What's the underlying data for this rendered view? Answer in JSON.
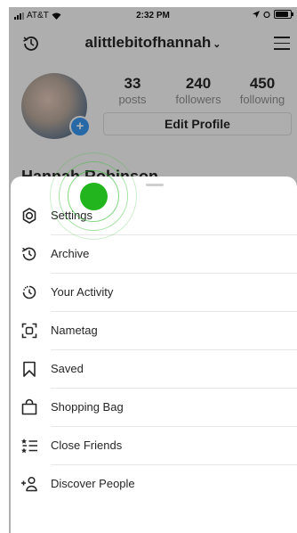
{
  "status_bar": {
    "carrier": "AT&T",
    "time": "2:32 PM"
  },
  "header": {
    "username": "alittlebitofhannah",
    "chevron": "⌄"
  },
  "profile": {
    "posts_count": "33",
    "posts_label": "posts",
    "followers_count": "240",
    "followers_label": "followers",
    "following_count": "450",
    "following_label": "following",
    "edit_profile": "Edit Profile",
    "name": "Hannah Robinson"
  },
  "menu": {
    "items": [
      {
        "label": "Settings",
        "icon": "gear-icon"
      },
      {
        "label": "Archive",
        "icon": "archive-icon"
      },
      {
        "label": "Your Activity",
        "icon": "activity-icon"
      },
      {
        "label": "Nametag",
        "icon": "nametag-icon"
      },
      {
        "label": "Saved",
        "icon": "bookmark-icon"
      },
      {
        "label": "Shopping Bag",
        "icon": "shopping-bag-icon"
      },
      {
        "label": "Close Friends",
        "icon": "close-friends-icon"
      },
      {
        "label": "Discover People",
        "icon": "discover-people-icon"
      }
    ]
  },
  "colors": {
    "tap_indicator": "#22b51e",
    "accent": "#3897f0"
  }
}
